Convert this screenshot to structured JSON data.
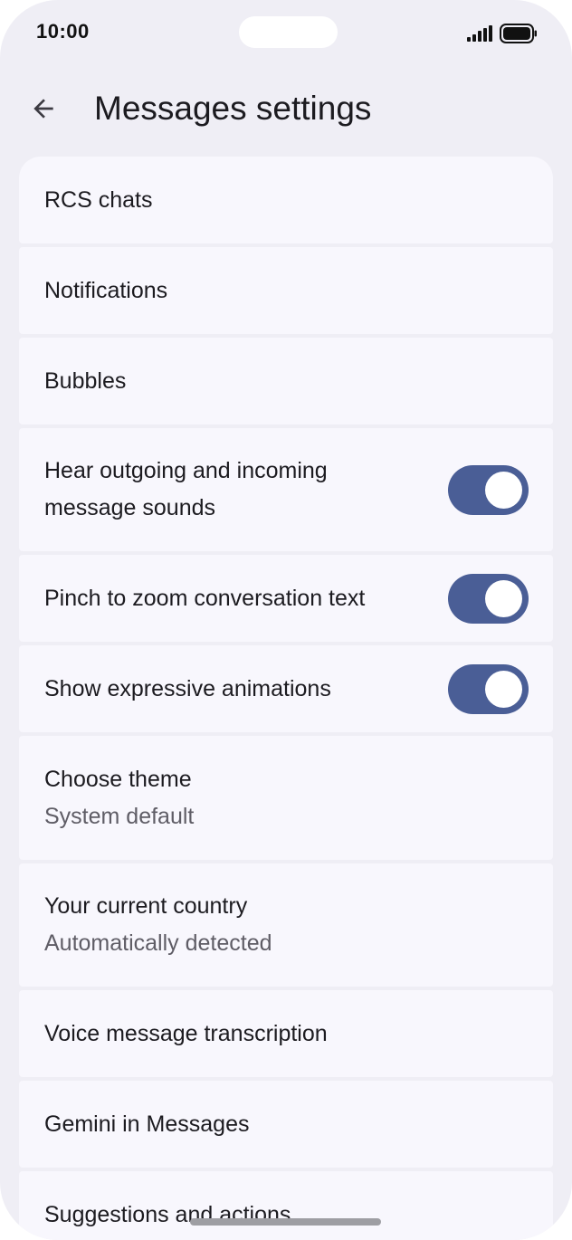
{
  "status_bar": {
    "time": "10:00",
    "signal_icon": "cellular-signal-icon",
    "battery_icon": "battery-full-icon"
  },
  "app_bar": {
    "back_icon": "arrow-back-icon",
    "title": "Messages settings"
  },
  "settings": {
    "items": [
      {
        "title": "RCS chats"
      },
      {
        "title": "Notifications"
      },
      {
        "title": "Bubbles"
      },
      {
        "title": "Hear outgoing and incoming message sounds",
        "title_line1": "Hear outgoing and incoming",
        "title_line2": "message sounds",
        "toggle": true
      },
      {
        "title": "Pinch to zoom conversation text",
        "toggle": true
      },
      {
        "title": "Show expressive animations",
        "toggle": true
      },
      {
        "title": "Choose theme",
        "subtitle": "System default"
      },
      {
        "title": "Your current country",
        "subtitle": "Automatically detected"
      },
      {
        "title": "Voice message transcription"
      },
      {
        "title": "Gemini in Messages"
      },
      {
        "title": "Suggestions and actions"
      }
    ]
  },
  "colors": {
    "background": "#efeef5",
    "card": "#f8f7fd",
    "toggle_on": "#4a5e96",
    "text_primary": "#1c1b20",
    "text_secondary": "#5f5d66"
  }
}
